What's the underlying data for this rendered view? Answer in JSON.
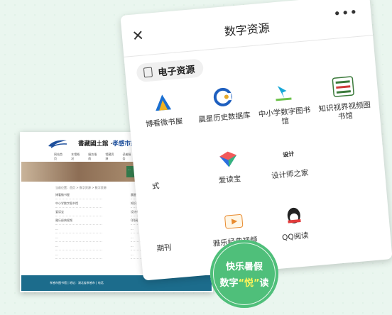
{
  "phone": {
    "title": "数字资源",
    "close": "✕",
    "more": "•••",
    "section_label": "电子资源",
    "items": [
      {
        "label": "博看微书屋",
        "icon": "bokan-logo-icon",
        "color": "#1b6fd1"
      },
      {
        "label": "晨星历史数据库",
        "icon": "chenxing-logo-icon",
        "color": "#1e5fbf"
      },
      {
        "label": "中小学数字图书馆",
        "icon": "zhongxiaoxue-logo-icon",
        "color": "#19a8d8"
      },
      {
        "label": "知识视界视频图书馆",
        "icon": "zhishishijie-logo-icon",
        "color": "#3b7a3b"
      },
      {
        "label": "式",
        "icon": "",
        "color": ""
      },
      {
        "label": "爱读宝",
        "icon": "aidubao-logo-icon",
        "color": "#2c6fe0"
      },
      {
        "label": "设计师之家",
        "icon": "shejishi-logo-icon",
        "color": "#333"
      },
      {
        "label": "",
        "icon": "",
        "color": ""
      },
      {
        "label": "期刊",
        "icon": "",
        "color": ""
      },
      {
        "label": "雅乐经典视频",
        "icon": "yale-logo-icon",
        "color": "#e88a2e"
      },
      {
        "label": "QQ阅读",
        "icon": "qq-reading-icon",
        "color": "#222"
      }
    ]
  },
  "web": {
    "title_prefix": "書藏國土館 ·",
    "title": "孝感市数字图书馆",
    "nav": [
      "网站首页",
      "本馆概况",
      "服务指南",
      "馆藏资源",
      "读者服务",
      "数字资源",
      "地方文献",
      "最新活动",
      "联系我们",
      "数字资源中心"
    ],
    "banner_text": "...",
    "crumb": "当前位置：首页 > 数字资源 > 数字资源",
    "list": [
      "博看微书屋",
      "晨星历史数据库",
      "中小学数字图书馆",
      "知识视界视频图书馆",
      "爱读宝",
      "设计师之家",
      "雅乐经典视频",
      "QQ阅读",
      "...",
      "...",
      "...",
      "...",
      "...",
      "...",
      "...",
      "..."
    ],
    "footer": "孝感市图书馆  |  地址：湖北省孝感市  |  电话"
  },
  "stamp": {
    "line1": "快乐暑假",
    "line2_pre": "数字",
    "line2_mid": "“悦”",
    "line2_post": "读"
  }
}
